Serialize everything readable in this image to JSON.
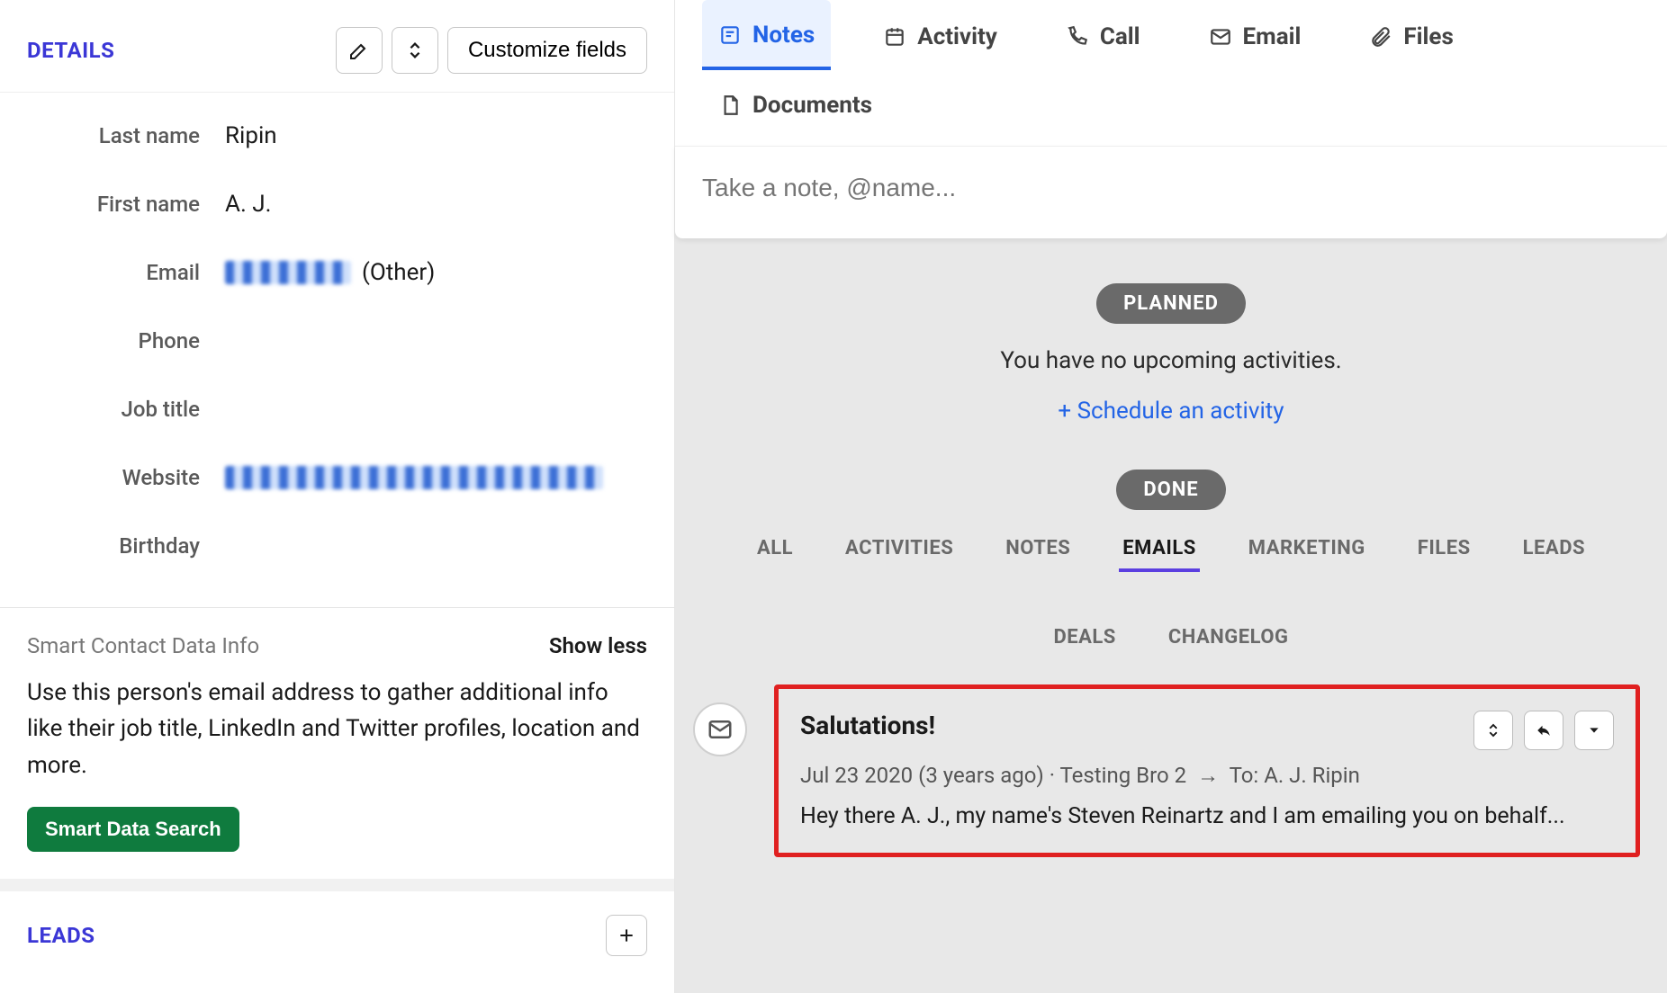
{
  "details": {
    "title": "DETAILS",
    "customize_label": "Customize fields",
    "fields": {
      "last_name": {
        "label": "Last name",
        "value": "Ripin"
      },
      "first_name": {
        "label": "First name",
        "value": "A. J."
      },
      "email": {
        "label": "Email",
        "suffix": "(Other)"
      },
      "phone": {
        "label": "Phone",
        "value": ""
      },
      "job_title": {
        "label": "Job title",
        "value": ""
      },
      "website": {
        "label": "Website"
      },
      "birthday": {
        "label": "Birthday",
        "value": ""
      }
    }
  },
  "smart": {
    "title": "Smart Contact Data Info",
    "toggle": "Show less",
    "description": "Use this person's email address to gather additional info like their job title, LinkedIn and Twitter profiles, location and more.",
    "button": "Smart Data Search"
  },
  "leads": {
    "title": "LEADS"
  },
  "tabs": {
    "notes": "Notes",
    "activity": "Activity",
    "call": "Call",
    "email": "Email",
    "files": "Files",
    "documents": "Documents"
  },
  "note_placeholder": "Take a note, @name...",
  "planned": {
    "pill": "PLANNED",
    "empty": "You have no upcoming activities.",
    "schedule": "+ Schedule an activity"
  },
  "done_pill": "DONE",
  "filters": {
    "all": "ALL",
    "activities": "ACTIVITIES",
    "notes": "NOTES",
    "emails": "EMAILS",
    "marketing": "MARKETING",
    "files": "FILES",
    "leads": "LEADS",
    "deals": "DEALS",
    "changelog": "CHANGELOG"
  },
  "email_item": {
    "subject": "Salutations!",
    "date": "Jul 23 2020 (3 years ago)",
    "sender": "Testing Bro 2",
    "to_prefix": "To:",
    "recipient": "A. J. Ripin",
    "preview": "Hey there A. J., my name's Steven Reinartz and I am emailing you on behalf..."
  }
}
